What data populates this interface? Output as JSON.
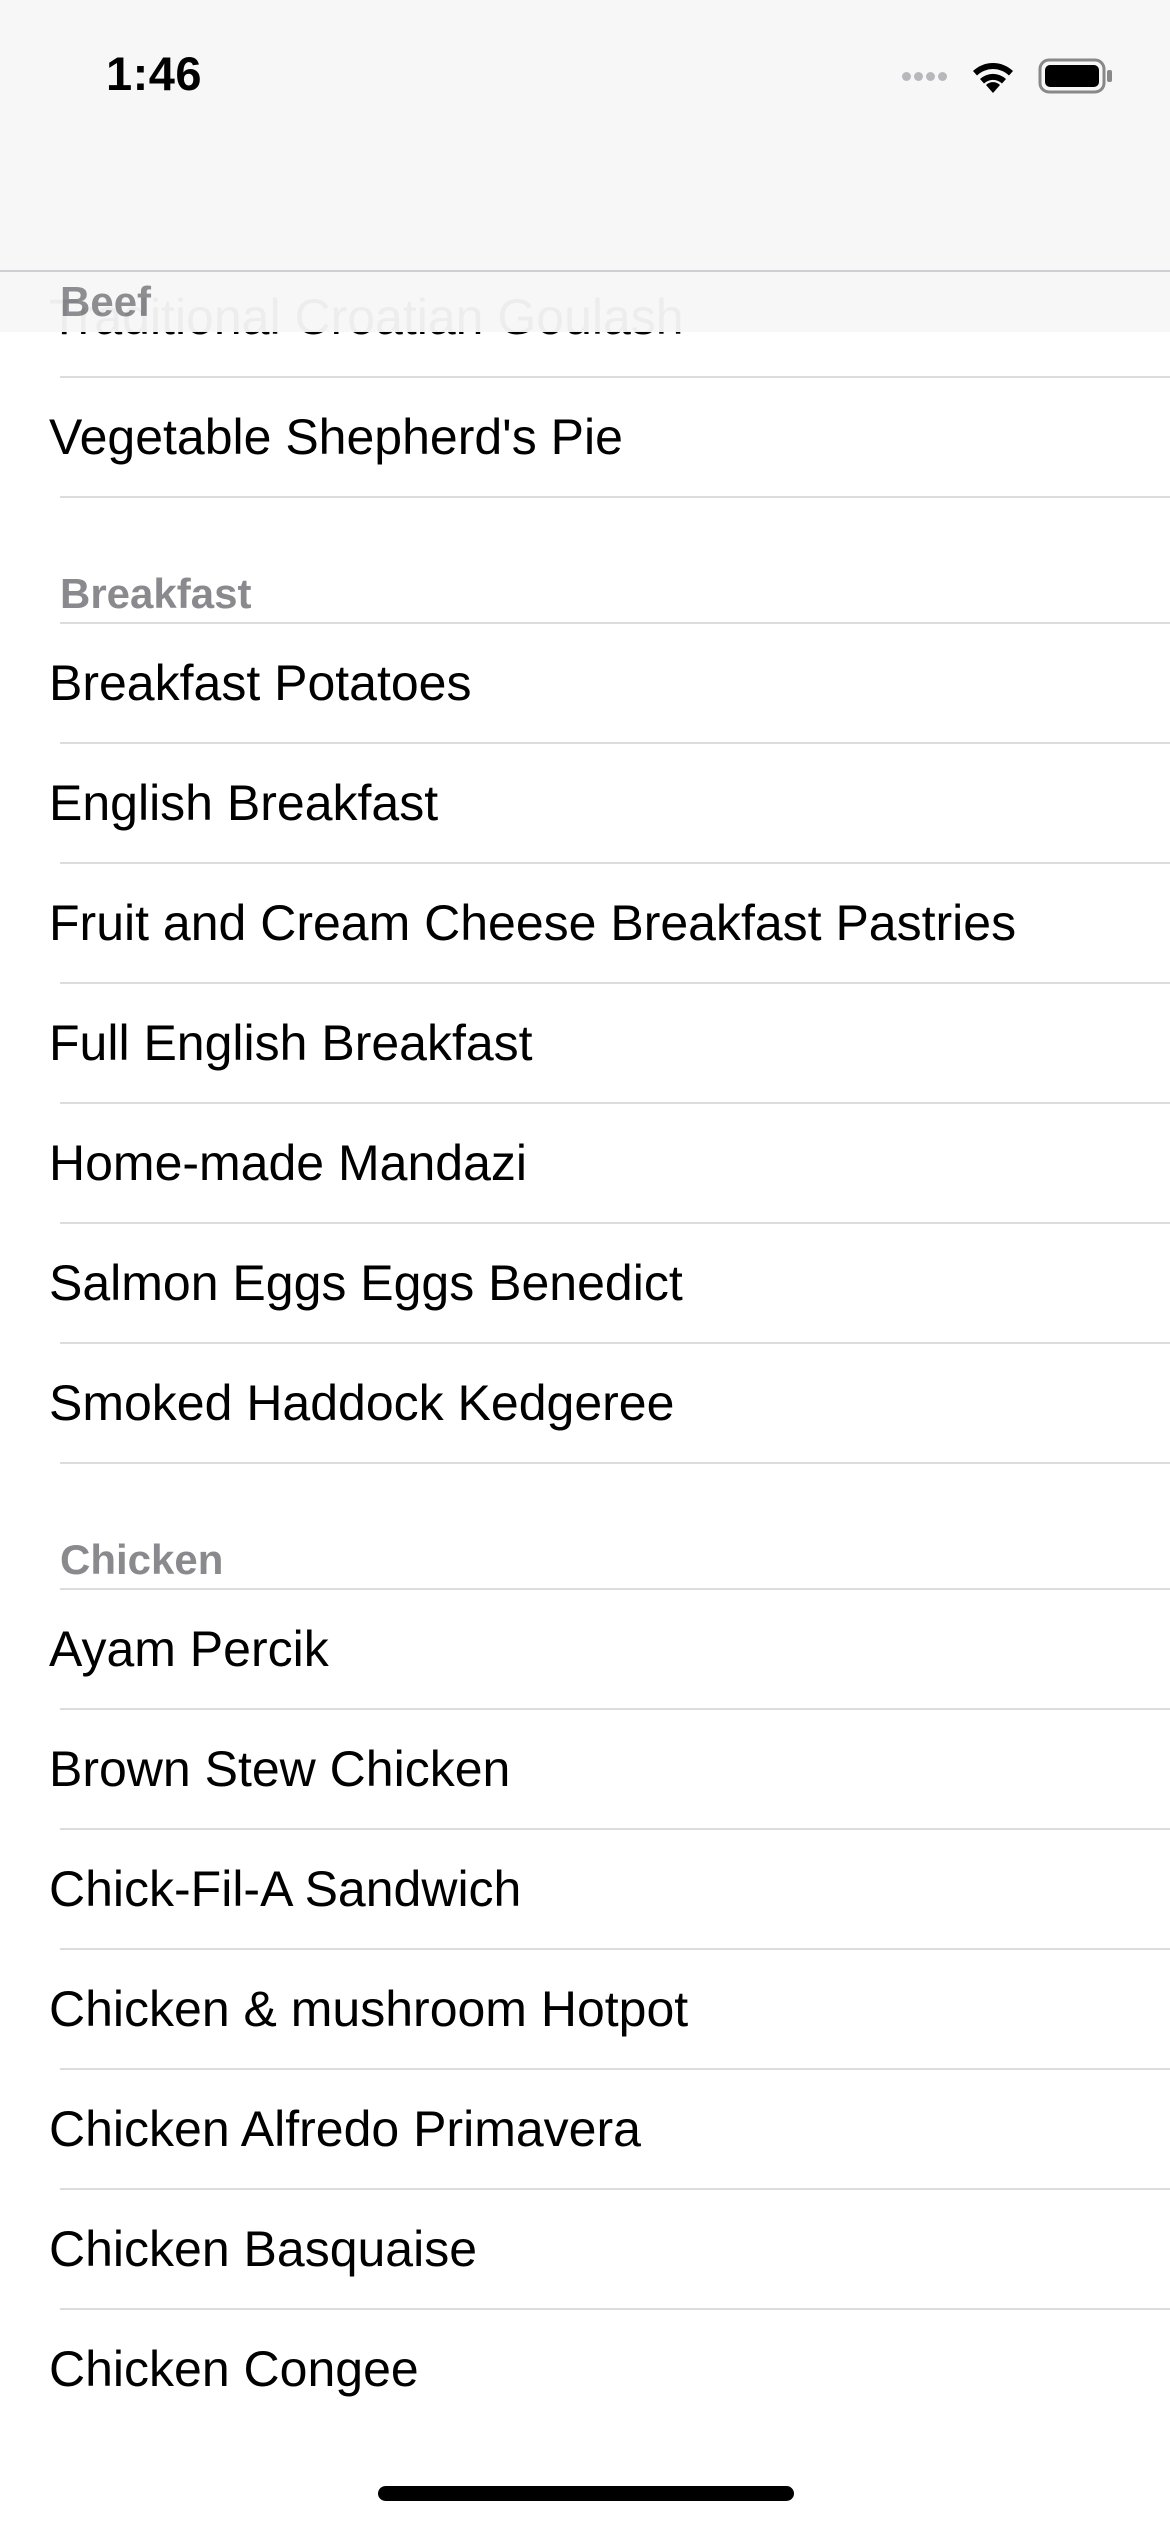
{
  "status_bar": {
    "time": "1:46",
    "icons": [
      "cellular-signal-icon",
      "wifi-icon",
      "battery-icon"
    ]
  },
  "sticky_header": "Beef",
  "partial_row": "Traditional Croatian Goulash",
  "sections": [
    {
      "title": "Beef",
      "items": [
        "Vegetable Shepherd's Pie"
      ]
    },
    {
      "title": "Breakfast",
      "items": [
        "Breakfast Potatoes",
        "English Breakfast",
        "Fruit and Cream Cheese Breakfast Pastries",
        "Full English Breakfast",
        "Home-made Mandazi",
        "Salmon Eggs Eggs Benedict",
        "Smoked Haddock Kedgeree"
      ]
    },
    {
      "title": "Chicken",
      "items": [
        "Ayam Percik",
        "Brown Stew Chicken",
        "Chick-Fil-A Sandwich",
        "Chicken & mushroom Hotpot",
        "Chicken Alfredo Primavera",
        "Chicken Basquaise",
        "Chicken Congee"
      ]
    }
  ],
  "colors": {
    "nav_background": "#f7f7f7",
    "section_header_text": "#8a8a8e",
    "separator": "#dcdcdf",
    "text": "#000000"
  }
}
